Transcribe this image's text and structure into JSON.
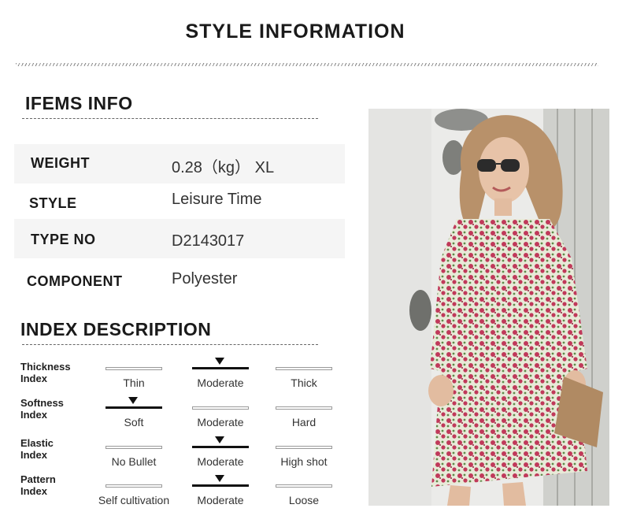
{
  "header": {
    "title": "STYLE INFORMATION"
  },
  "items_info": {
    "title": "IFEMS INFO",
    "rows": [
      {
        "label": "WEIGHT",
        "value": "0.28（kg） XL"
      },
      {
        "label": "STYLE",
        "value": "Leisure Time"
      },
      {
        "label": "TYPE NO",
        "value": "D2143017"
      },
      {
        "label": "COMPONENT",
        "value": "Polyester"
      }
    ]
  },
  "index_description": {
    "title": "INDEX DESCRIPTION",
    "rows": [
      {
        "label_line1": "Thickness",
        "label_line2": "Index",
        "options": [
          "Thin",
          "Moderate",
          "Thick"
        ],
        "selected": 1
      },
      {
        "label_line1": "Softness",
        "label_line2": "Index",
        "options": [
          "Soft",
          "Moderate",
          "Hard"
        ],
        "selected": 0
      },
      {
        "label_line1": "Elastic",
        "label_line2": "Index",
        "options": [
          "No Bullet",
          "Moderate",
          "High shot"
        ],
        "selected": 1
      },
      {
        "label_line1": "Pattern",
        "label_line2": "Index",
        "options": [
          "Self cultivation",
          "Moderate",
          "Loose"
        ],
        "selected": 1
      }
    ]
  },
  "colors": {
    "selected_bar": "#111111",
    "unselected_bar": "#999999",
    "row_shade": "#f5f5f5",
    "dress_print": "#c0395a"
  }
}
